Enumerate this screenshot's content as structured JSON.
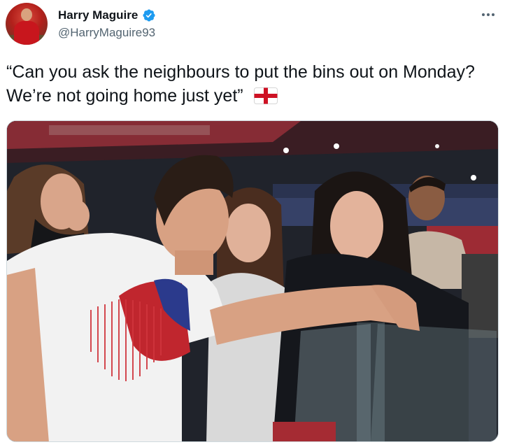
{
  "tweet": {
    "author": {
      "display_name": "Harry Maguire",
      "handle": "@HarryMaguire93",
      "verified": true,
      "avatar_icon": "profile-photo-avatar"
    },
    "more_icon": "more-options-icon",
    "text": "“Can you ask the neighbours to put the bins out on Monday? We’re not going home just yet”",
    "emoji": "england-flag",
    "media": {
      "type": "photo",
      "icon": "photo"
    }
  },
  "colors": {
    "verified": "#1d9bf0",
    "text": "#0f1419",
    "secondary": "#536471",
    "border": "#cfd9de",
    "flag_red": "#ce1124"
  }
}
